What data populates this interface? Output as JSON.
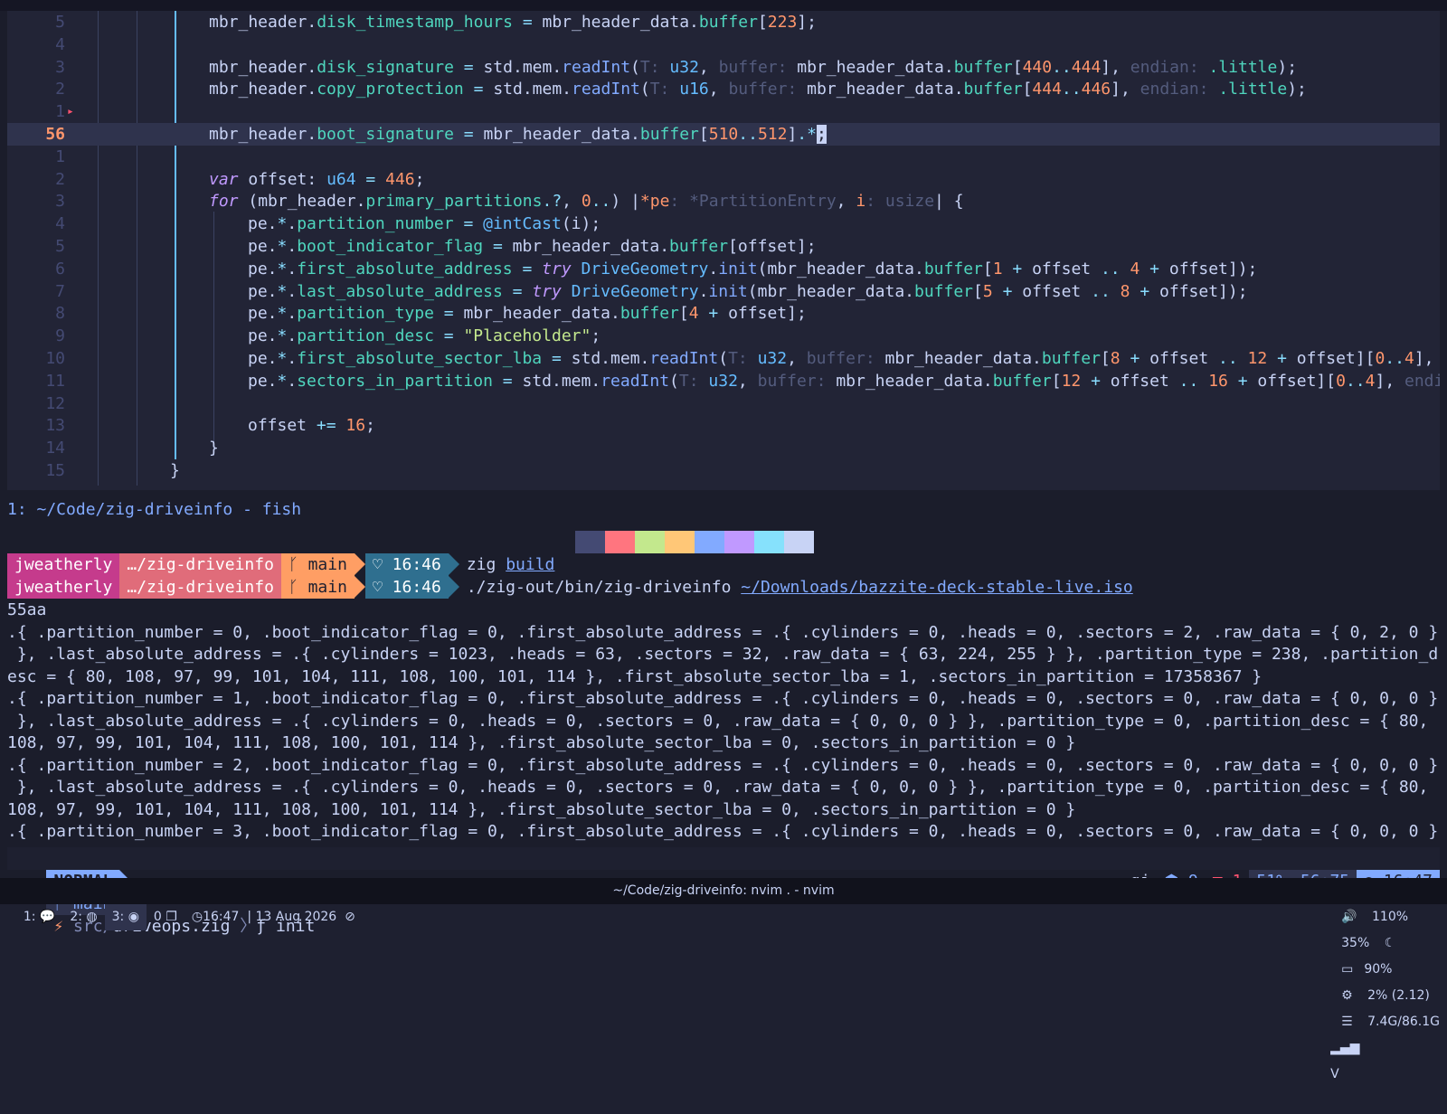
{
  "editor": {
    "lines": [
      {
        "num": "5",
        "cur": false,
        "sign": "",
        "indent": 4,
        "html": "<span class=\"pun\">mbr_header.</span><span class=\"fld\">disk_timestamp_hours</span> <span class=\"op\">=</span> <span class=\"pun\">mbr_header_data.</span><span class=\"fld\">buffer</span><span class=\"pun\">[</span><span class=\"num\">223</span><span class=\"pun\">];</span>"
      },
      {
        "num": "4",
        "cur": false,
        "sign": "",
        "indent": 4,
        "html": ""
      },
      {
        "num": "3",
        "cur": false,
        "sign": "",
        "indent": 4,
        "html": "<span class=\"pun\">mbr_header.</span><span class=\"fld\">disk_signature</span> <span class=\"op\">=</span> <span class=\"pun\">std.mem.</span><span class=\"fn\">readInt</span><span class=\"pun\">(</span><span class=\"hint\">T: </span><span class=\"ty\">u32</span><span class=\"pun\">, </span><span class=\"hint\">buffer: </span><span class=\"pun\">mbr_header_data.</span><span class=\"fld\">buffer</span><span class=\"pun\">[</span><span class=\"num\">440</span><span class=\"op\">..</span><span class=\"num\">444</span><span class=\"pun\">], </span><span class=\"hint\">endian: </span><span class=\"fld\">.little</span><span class=\"pun\">);</span>"
      },
      {
        "num": "2",
        "cur": false,
        "sign": "",
        "indent": 4,
        "html": "<span class=\"pun\">mbr_header.</span><span class=\"fld\">copy_protection</span> <span class=\"op\">=</span> <span class=\"pun\">std.mem.</span><span class=\"fn\">readInt</span><span class=\"pun\">(</span><span class=\"hint\">T: </span><span class=\"ty\">u16</span><span class=\"pun\">, </span><span class=\"hint\">buffer: </span><span class=\"pun\">mbr_header_data.</span><span class=\"fld\">buffer</span><span class=\"pun\">[</span><span class=\"num\">444</span><span class=\"op\">..</span><span class=\"num\">446</span><span class=\"pun\">], </span><span class=\"hint\">endian: </span><span class=\"fld\">.little</span><span class=\"pun\">);</span>"
      },
      {
        "num": "1",
        "cur": false,
        "sign": "▸",
        "indent": 4,
        "html": ""
      },
      {
        "num": "56",
        "cur": true,
        "sign": "",
        "indent": 4,
        "html": "<span class=\"pun\">mbr_header.</span><span class=\"fld\">boot_signature</span> <span class=\"op\">=</span> <span class=\"pun\">mbr_header_data.</span><span class=\"fld\">buffer</span><span class=\"pun\">[</span><span class=\"num\">510</span><span class=\"op\">..</span><span class=\"num\">512</span><span class=\"pun\">]</span><span class=\"op\">.*</span><span class=\"cursor\">;</span>"
      },
      {
        "num": "1",
        "cur": false,
        "sign": "",
        "indent": 4,
        "html": ""
      },
      {
        "num": "2",
        "cur": false,
        "sign": "",
        "indent": 4,
        "html": "<span class=\"k\">var</span> <span class=\"pun\">offset: </span><span class=\"ty\">u64</span> <span class=\"op\">=</span> <span class=\"num\">446</span><span class=\"pun\">;</span>"
      },
      {
        "num": "3",
        "cur": false,
        "sign": "",
        "indent": 4,
        "html": "<span class=\"k\">for</span> <span class=\"pun\">(mbr_header.</span><span class=\"fld\">primary_partitions</span><span class=\"op\">.?</span><span class=\"pun\">, </span><span class=\"num\">0</span><span class=\"op\">..</span><span class=\"pun\">) |</span><span class=\"pa\">*pe</span><span class=\"hint\">: *PartitionEntry</span><span class=\"pun\">, </span><span class=\"pa\">i</span><span class=\"hint\">: usize</span><span class=\"pun\">| {</span>"
      },
      {
        "num": "4",
        "cur": false,
        "sign": "",
        "indent": 8,
        "html": "<span class=\"pun\">pe.</span><span class=\"op\">*</span><span class=\"pun\">.</span><span class=\"fld\">partition_number</span> <span class=\"op\">=</span> <span class=\"bi\">@intCast</span><span class=\"pun\">(i);</span>"
      },
      {
        "num": "5",
        "cur": false,
        "sign": "",
        "indent": 8,
        "html": "<span class=\"pun\">pe.</span><span class=\"op\">*</span><span class=\"pun\">.</span><span class=\"fld\">boot_indicator_flag</span> <span class=\"op\">=</span> <span class=\"pun\">mbr_header_data.</span><span class=\"fld\">buffer</span><span class=\"pun\">[offset];</span>"
      },
      {
        "num": "6",
        "cur": false,
        "sign": "",
        "indent": 8,
        "html": "<span class=\"pun\">pe.</span><span class=\"op\">*</span><span class=\"pun\">.</span><span class=\"fld\">first_absolute_address</span> <span class=\"op\">=</span> <span class=\"k\">try</span> <span class=\"ty\">DriveGeometry</span><span class=\"pun\">.</span><span class=\"fn\">init</span><span class=\"pun\">(mbr_header_data.</span><span class=\"fld\">buffer</span><span class=\"pun\">[</span><span class=\"num\">1</span> <span class=\"op\">+</span> <span class=\"pun\">offset </span><span class=\"op\">..</span> <span class=\"num\">4</span> <span class=\"op\">+</span> <span class=\"pun\">offset]);</span>"
      },
      {
        "num": "7",
        "cur": false,
        "sign": "",
        "indent": 8,
        "html": "<span class=\"pun\">pe.</span><span class=\"op\">*</span><span class=\"pun\">.</span><span class=\"fld\">last_absolute_address</span> <span class=\"op\">=</span> <span class=\"k\">try</span> <span class=\"ty\">DriveGeometry</span><span class=\"pun\">.</span><span class=\"fn\">init</span><span class=\"pun\">(mbr_header_data.</span><span class=\"fld\">buffer</span><span class=\"pun\">[</span><span class=\"num\">5</span> <span class=\"op\">+</span> <span class=\"pun\">offset </span><span class=\"op\">..</span> <span class=\"num\">8</span> <span class=\"op\">+</span> <span class=\"pun\">offset]);</span>"
      },
      {
        "num": "8",
        "cur": false,
        "sign": "",
        "indent": 8,
        "html": "<span class=\"pun\">pe.</span><span class=\"op\">*</span><span class=\"pun\">.</span><span class=\"fld\">partition_type</span> <span class=\"op\">=</span> <span class=\"pun\">mbr_header_data.</span><span class=\"fld\">buffer</span><span class=\"pun\">[</span><span class=\"num\">4</span> <span class=\"op\">+</span> <span class=\"pun\">offset];</span>"
      },
      {
        "num": "9",
        "cur": false,
        "sign": "",
        "indent": 8,
        "html": "<span class=\"pun\">pe.</span><span class=\"op\">*</span><span class=\"pun\">.</span><span class=\"fld\">partition_desc</span> <span class=\"op\">=</span> <span class=\"str\">\"Placeholder\"</span><span class=\"pun\">;</span>"
      },
      {
        "num": "10",
        "cur": false,
        "sign": "",
        "indent": 8,
        "html": "<span class=\"pun\">pe.</span><span class=\"op\">*</span><span class=\"pun\">.</span><span class=\"fld\">first_absolute_sector_lba</span> <span class=\"op\">=</span> <span class=\"pun\">std.mem.</span><span class=\"fn\">readInt</span><span class=\"pun\">(</span><span class=\"hint\">T: </span><span class=\"ty\">u32</span><span class=\"pun\">, </span><span class=\"hint\">buffer: </span><span class=\"pun\">mbr_header_data.</span><span class=\"fld\">buffer</span><span class=\"pun\">[</span><span class=\"num\">8</span> <span class=\"op\">+</span> <span class=\"pun\">offset </span><span class=\"op\">..</span> <span class=\"num\">12</span> <span class=\"op\">+</span> <span class=\"pun\">offset][</span><span class=\"num\">0</span><span class=\"op\">..</span><span class=\"num\">4</span><span class=\"pun\">],</span>"
      },
      {
        "num": "11",
        "cur": false,
        "sign": "",
        "indent": 8,
        "html": "<span class=\"pun\">pe.</span><span class=\"op\">*</span><span class=\"pun\">.</span><span class=\"fld\">sectors_in_partition</span> <span class=\"op\">=</span> <span class=\"pun\">std.mem.</span><span class=\"fn\">readInt</span><span class=\"pun\">(</span><span class=\"hint\">T: </span><span class=\"ty\">u32</span><span class=\"pun\">, </span><span class=\"hint\">buffer: </span><span class=\"pun\">mbr_header_data.</span><span class=\"fld\">buffer</span><span class=\"pun\">[</span><span class=\"num\">12</span> <span class=\"op\">+</span> <span class=\"pun\">offset </span><span class=\"op\">..</span> <span class=\"num\">16</span> <span class=\"op\">+</span> <span class=\"pun\">offset][</span><span class=\"num\">0</span><span class=\"op\">..</span><span class=\"num\">4</span><span class=\"pun\">], </span><span class=\"hint\">endi</span>"
      },
      {
        "num": "12",
        "cur": false,
        "sign": "",
        "indent": 8,
        "html": ""
      },
      {
        "num": "13",
        "cur": false,
        "sign": "",
        "indent": 8,
        "html": "<span class=\"pun\">offset </span><span class=\"op\">+=</span> <span class=\"num\">16</span><span class=\"pun\">;</span>"
      },
      {
        "num": "14",
        "cur": false,
        "sign": "",
        "indent": 4,
        "html": "<span class=\"pun\">}</span>"
      },
      {
        "num": "15",
        "cur": false,
        "sign": "",
        "indent": 0,
        "html": "<span class=\"pun\">}</span>"
      }
    ]
  },
  "terminal": {
    "title": "1: ~/Code/zig-driveinfo - fish",
    "swatches": [
      "#444a73",
      "#ff757f",
      "#c3e88d",
      "#ffc777",
      "#82aaff",
      "#c099ff",
      "#86e1fc",
      "#c8d3f5"
    ],
    "prompts": [
      {
        "user": "jweatherly",
        "path": "…/zig-driveinfo",
        "branch": "main",
        "time": "16:46",
        "cmd": "zig ",
        "arg": "build"
      },
      {
        "user": "jweatherly",
        "path": "…/zig-driveinfo",
        "branch": "main",
        "time": "16:46",
        "cmd": "./zig-out/bin/zig-driveinfo ",
        "arg": "~/Downloads/bazzite-deck-stable-live.iso"
      }
    ],
    "output": [
      "55aa",
      ".{ .partition_number = 0, .boot_indicator_flag = 0, .first_absolute_address = .{ .cylinders = 0, .heads = 0, .sectors = 2, .raw_data = { 0, 2, 0 }",
      " }, .last_absolute_address = .{ .cylinders = 1023, .heads = 63, .sectors = 32, .raw_data = { 63, 224, 255 } }, .partition_type = 238, .partition_d",
      "esc = { 80, 108, 97, 99, 101, 104, 111, 108, 100, 101, 114 }, .first_absolute_sector_lba = 1, .sectors_in_partition = 17358367 }",
      ".{ .partition_number = 1, .boot_indicator_flag = 0, .first_absolute_address = .{ .cylinders = 0, .heads = 0, .sectors = 0, .raw_data = { 0, 0, 0 }",
      " }, .last_absolute_address = .{ .cylinders = 0, .heads = 0, .sectors = 0, .raw_data = { 0, 0, 0 } }, .partition_type = 0, .partition_desc = { 80,",
      "108, 97, 99, 101, 104, 111, 108, 100, 101, 114 }, .first_absolute_sector_lba = 0, .sectors_in_partition = 0 }",
      ".{ .partition_number = 2, .boot_indicator_flag = 0, .first_absolute_address = .{ .cylinders = 0, .heads = 0, .sectors = 0, .raw_data = { 0, 0, 0 }",
      " }, .last_absolute_address = .{ .cylinders = 0, .heads = 0, .sectors = 0, .raw_data = { 0, 0, 0 } }, .partition_type = 0, .partition_desc = { 80,",
      "108, 97, 99, 101, 104, 111, 108, 100, 101, 114 }, .first_absolute_sector_lba = 0, .sectors_in_partition = 0 }",
      ".{ .partition_number = 3, .boot_indicator_flag = 0, .first_absolute_address = .{ .cylinders = 0, .heads = 0, .sectors = 0, .raw_data = { 0, 0, 0 }"
    ]
  },
  "statusline": {
    "mode": "NORMAL",
    "branch_icon": "ᚴ",
    "branch": "main",
    "file_dir": "src/",
    "file_name": "driveops.zig",
    "sep": "〉",
    "func_icon": "ƒ",
    "func": "init",
    "keys": "gj",
    "lsp_count": "9",
    "err_count": "1",
    "percent": "51%",
    "position": "56:75",
    "time": "16:47"
  },
  "taskbar": {
    "workspaces": [
      "1:",
      "2:",
      "3:"
    ],
    "win_count": "0",
    "clock": "16:47",
    "date": "13 Aug 2026",
    "window_title": "~/Code/zig-driveinfo: nvim . - nvim",
    "volume": "110%",
    "brightness": "35%",
    "battery": "90%",
    "cpu": "2% (2.12)",
    "mem": "7.4G/86.1G"
  },
  "colors": {
    "accent": "#82aaff",
    "mode_bg": "#82aaff",
    "user_bg": "#c53b8c",
    "path_bg": "#e06c7a",
    "branch_bg": "#ff9e64",
    "time_bg": "#2f6f8f",
    "error": "#ff5370"
  }
}
